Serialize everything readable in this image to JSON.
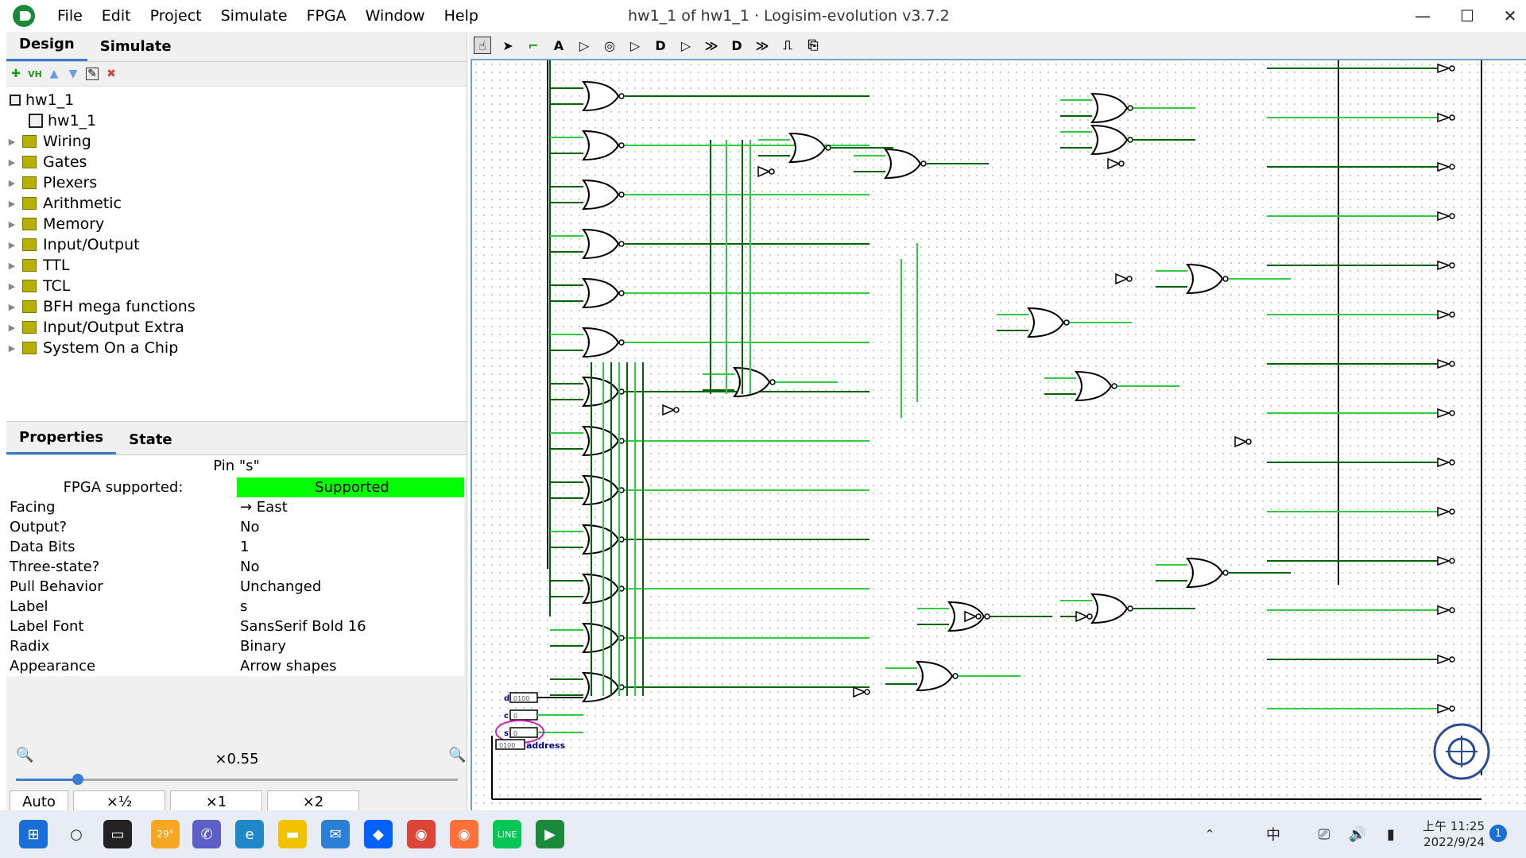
{
  "window": {
    "title": "hw1_1 of hw1_1 · Logisim-evolution v3.7.2"
  },
  "menu": [
    "File",
    "Edit",
    "Project",
    "Simulate",
    "FPGA",
    "Window",
    "Help"
  ],
  "left_tabs": {
    "design": "Design",
    "simulate": "Simulate"
  },
  "tree": {
    "project": "hw1_1",
    "circuit": "hw1_1",
    "libraries": [
      "Wiring",
      "Gates",
      "Plexers",
      "Arithmetic",
      "Memory",
      "Input/Output",
      "TTL",
      "TCL",
      "BFH mega functions",
      "Input/Output Extra",
      "System On a Chip"
    ]
  },
  "props_tabs": {
    "properties": "Properties",
    "state": "State"
  },
  "pin_title": "Pin \"s\"",
  "fpga": {
    "label": "FPGA supported:",
    "value": "Supported",
    "color": "#00ff00"
  },
  "properties": [
    {
      "k": "Facing",
      "v": "→ East"
    },
    {
      "k": "Output?",
      "v": "No"
    },
    {
      "k": "Data Bits",
      "v": "1"
    },
    {
      "k": "Three-state?",
      "v": "No"
    },
    {
      "k": "Pull Behavior",
      "v": "Unchanged"
    },
    {
      "k": "Label",
      "v": "s"
    },
    {
      "k": "Label Font",
      "v": "SansSerif Bold 16"
    },
    {
      "k": "Radix",
      "v": "Binary"
    },
    {
      "k": "Appearance",
      "v": "Arrow shapes"
    }
  ],
  "zoom": {
    "level": "×0.55",
    "slider_fraction": 0.14,
    "buttons": [
      "Auto",
      "×½",
      "×1",
      "×2"
    ]
  },
  "canvas": {
    "inputs": [
      {
        "label": "d",
        "value": "0100"
      },
      {
        "label": "c",
        "value": "0"
      },
      {
        "label": "s",
        "value": "0"
      }
    ],
    "output_label": "address",
    "output_value": "0100",
    "wire_on": "#2ecc40",
    "wire_off": "#006400"
  },
  "taskbar": {
    "weather": "29°",
    "time": "上午 11:25",
    "date": "2022/9/24",
    "notifications": "1",
    "ime": "中"
  }
}
